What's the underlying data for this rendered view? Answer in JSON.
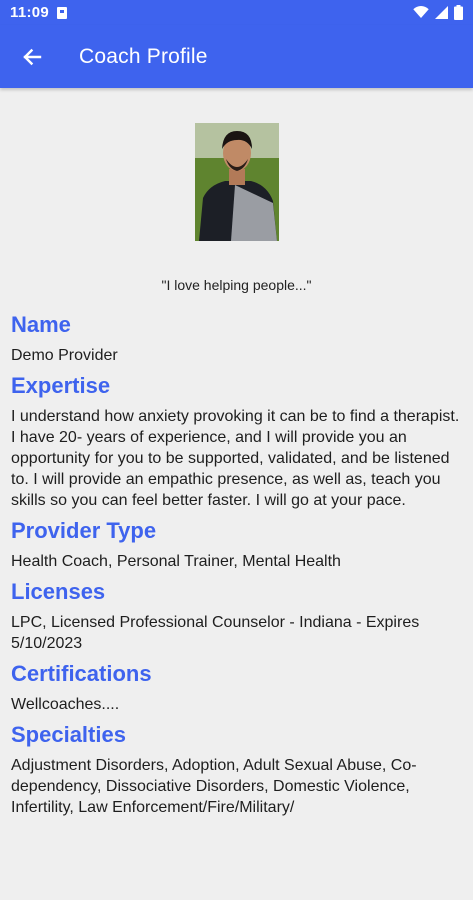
{
  "status": {
    "time": "11:09"
  },
  "app_bar": {
    "title": "Coach Profile"
  },
  "profile": {
    "quote": "\"I love helping people...\"",
    "sections": [
      {
        "title": "Name",
        "text": "Demo Provider"
      },
      {
        "title": "Expertise",
        "text": "I understand how anxiety provoking it can be to find a therapist. I have 20- years of experience, and I will provide you an opportunity for you to be supported, validated, and be listened to. I will provide an empathic presence, as well as, teach you skills so you can feel better faster. I will go at your pace."
      },
      {
        "title": "Provider Type",
        "text": "Health Coach, Personal Trainer, Mental Health"
      },
      {
        "title": "Licenses",
        "text": "LPC, Licensed Professional Counselor - Indiana - Expires 5/10/2023"
      },
      {
        "title": "Certifications",
        "text": "Wellcoaches...."
      },
      {
        "title": "Specialties",
        "text": "Adjustment Disorders, Adoption, Adult Sexual Abuse, Co-dependency, Dissociative Disorders, Domestic Violence, Infertility, Law Enforcement/Fire/Military/"
      }
    ]
  },
  "colors": {
    "accent": "#3e63ee",
    "background": "#efefef",
    "heading": "#3e63ee"
  },
  "icons": {
    "back": "arrow-left-icon",
    "wifi": "wifi-icon",
    "signal": "signal-icon",
    "battery": "battery-icon",
    "sd": "sd-card-icon"
  }
}
